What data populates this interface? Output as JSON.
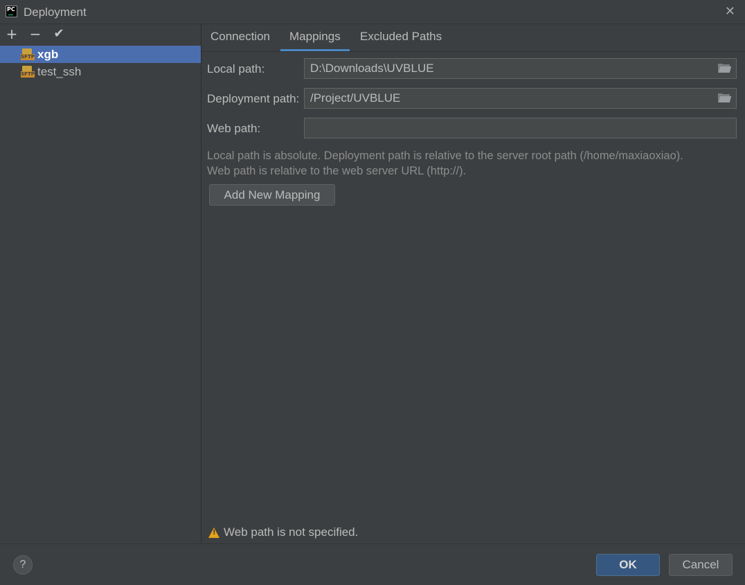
{
  "window": {
    "title": "Deployment",
    "app_icon_text": "PC",
    "close_glyph": "✕"
  },
  "toolbar": {
    "add_glyph": "+",
    "remove_glyph": "−",
    "default_glyph": "✔"
  },
  "servers": [
    {
      "name": "xgb",
      "icon": "sftp-server-icon",
      "icon_text": "SFTP",
      "selected": true
    },
    {
      "name": "test_ssh",
      "icon": "sftp-server-icon",
      "icon_text": "SFTP",
      "selected": false
    }
  ],
  "tabs": [
    {
      "label": "Connection",
      "active": false
    },
    {
      "label": "Mappings",
      "active": true
    },
    {
      "label": "Excluded Paths",
      "active": false
    }
  ],
  "mappings": {
    "local_path_label": "Local path:",
    "local_path_value": "D:\\Downloads\\UVBLUE",
    "deployment_path_label": "Deployment path:",
    "deployment_path_value": "/Project/UVBLUE",
    "web_path_label": "Web path:",
    "web_path_value": "",
    "hint_line1": "Local path is absolute. Deployment path is relative to the server root path (/home/maxiaoxiao).",
    "hint_line2": "Web path is relative to the web server URL (http://).",
    "add_button_label": "Add New Mapping"
  },
  "warning": {
    "icon": "warning-icon",
    "text": "Web path is not specified."
  },
  "footer": {
    "help_glyph": "?",
    "ok_label": "OK",
    "cancel_label": "Cancel"
  },
  "colors": {
    "background": "#3c3f41",
    "selection": "#4b6eaf",
    "tab_underline": "#4a88c7",
    "ok_button": "#365880",
    "warning": "#e6a21a"
  }
}
